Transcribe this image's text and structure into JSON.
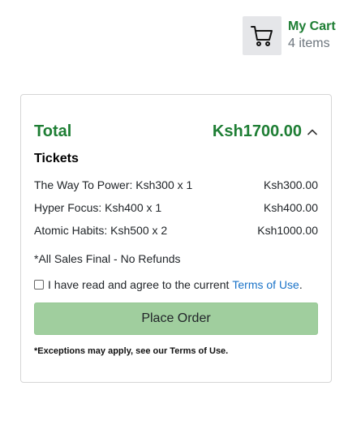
{
  "cart": {
    "icon": "shopping-cart-icon",
    "title": "My Cart",
    "count_label": "4 items"
  },
  "summary": {
    "total_label": "Total",
    "total_amount": "Ksh1700.00",
    "toggle_icon": "chevron-up-icon",
    "section_title": "Tickets",
    "items": [
      {
        "description": "The Way To Power: Ksh300 x 1",
        "amount": "Ksh300.00"
      },
      {
        "description": "Hyper Focus: Ksh400 x 1",
        "amount": "Ksh400.00"
      },
      {
        "description": "Atomic Habits: Ksh500 x 2",
        "amount": "Ksh1000.00"
      }
    ],
    "notice": "*All Sales Final - No Refunds",
    "agree_text": "I have read and agree to the current",
    "terms_link": "Terms of Use",
    "agree_suffix": ".",
    "agree_checked": false,
    "place_order_label": "Place Order",
    "footnote": "*Exceptions may apply, see our Terms of Use."
  },
  "colors": {
    "accent_green": "#1e7e34",
    "button_green": "#a0ce9e",
    "link_blue": "#1a73c8"
  }
}
